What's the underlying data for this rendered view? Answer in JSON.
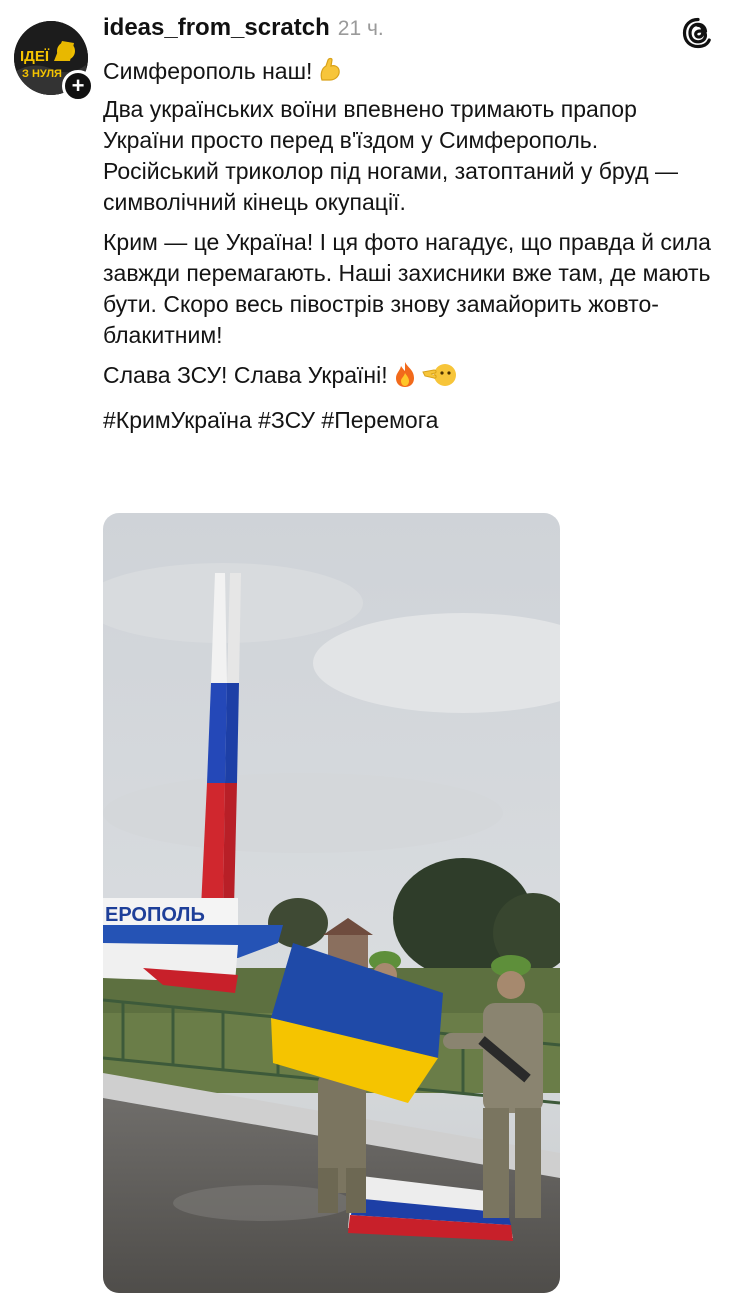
{
  "account": {
    "username": "ideas_from_scratch",
    "time": "21 ч.",
    "avatar_text_top": "ІДЕЇ",
    "avatar_text_bottom": "З НУЛЯ",
    "follow_symbol": "+"
  },
  "app": {
    "logo_icon": "threads-icon"
  },
  "post": {
    "line1": "Симферополь наш!",
    "para1": "Два українських воїни впевнено тримають прапор України просто перед в'їздом у Симферополь. Російський триколор під ногами, затоптаний у бруд — символічний кінець окупації.",
    "para2": "Крим — це Україна! І ця фото нагадує, що правда й сила завжди перемагають. Наші захисники вже там, де мають бути. Скоро весь півострів знову замайорить жовто-блакитним!",
    "para3": "Слава ЗСУ! Слава Україні!",
    "hashtags": "#КримУкраїна #ЗСУ #Перемога",
    "emojis": [
      "flexed-biceps-icon",
      "fire-icon",
      "pointing-face-icon"
    ]
  },
  "photo": {
    "sign_text": "ЕРОПОЛЬ"
  },
  "colors": {
    "flag_blue": "#1f4aa8",
    "flag_yellow": "#f5c400",
    "ru_red": "#c8202a",
    "ru_blue": "#1d3fa6"
  }
}
